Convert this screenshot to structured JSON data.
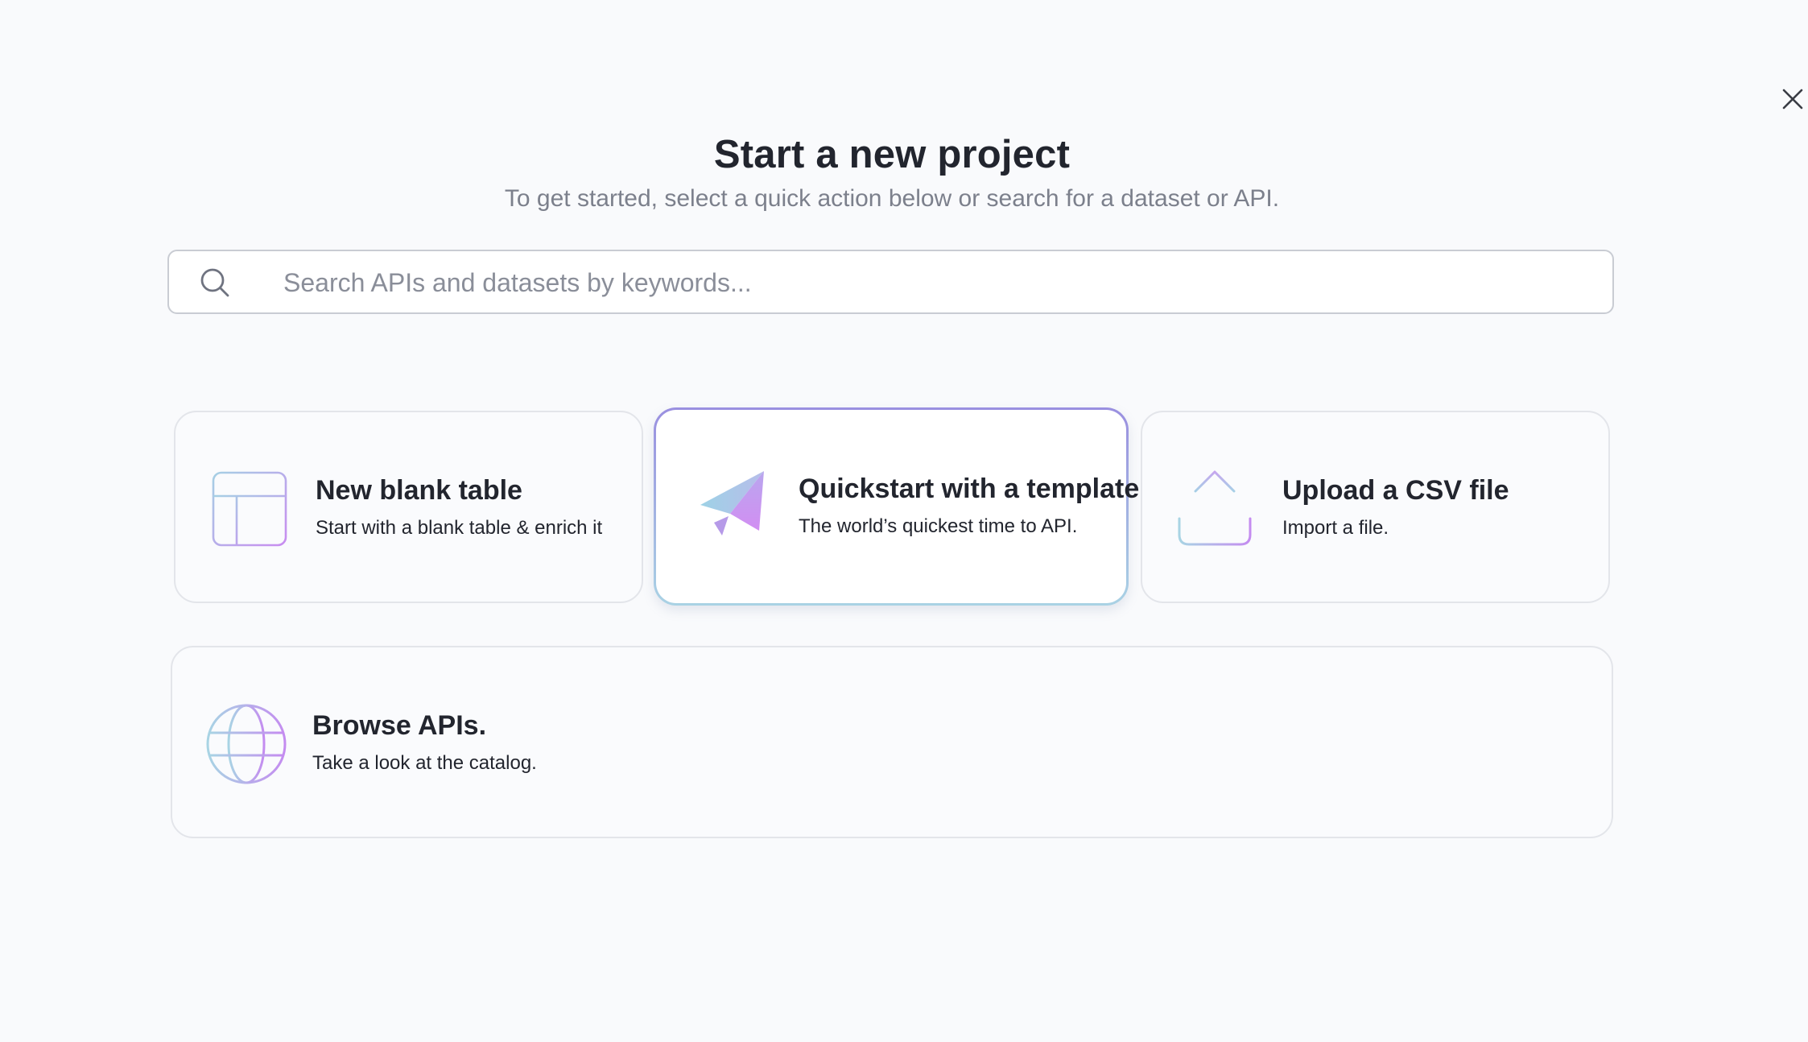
{
  "header": {
    "title": "Start a new project",
    "subtitle": "To get started, select a quick action below or search for a dataset or API."
  },
  "search": {
    "placeholder": "Search APIs and datasets by keywords...",
    "value": ""
  },
  "actions": [
    {
      "title": "New blank table",
      "description": "Start with a blank table & enrich it",
      "icon": "table-icon",
      "selected": false
    },
    {
      "title": "Quickstart with a template",
      "description": "The world’s quickest time to API.",
      "icon": "paper-plane-icon",
      "selected": true
    },
    {
      "title": "Upload a CSV file",
      "description": "Import a file.",
      "icon": "upload-icon",
      "selected": false
    },
    {
      "title": "Browse APIs.",
      "description": "Take a look at the catalog.",
      "icon": "globe-icon",
      "selected": false
    }
  ],
  "colors": {
    "background": "#f9fafc",
    "icon_gradient_start": "#a9d2e4",
    "icon_gradient_end": "#c58ef0",
    "selected_border_top": "#9a8fe0",
    "selected_border_bottom": "#a9d2e4"
  }
}
